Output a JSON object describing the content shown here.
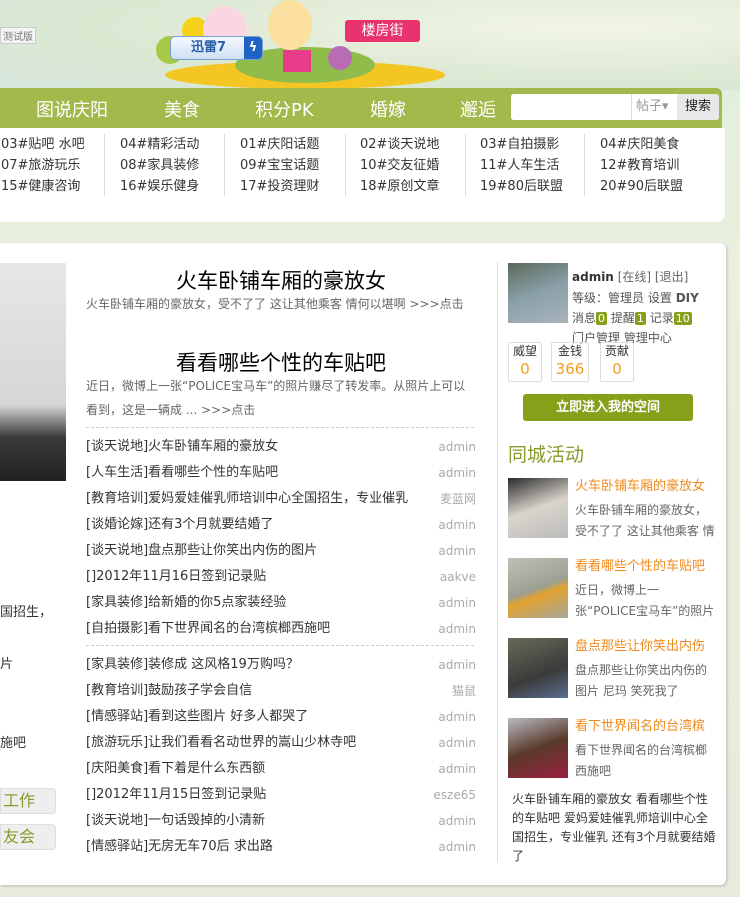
{
  "header": {
    "test_label": "测试版",
    "xunlei_label": "迅雷7",
    "loufang_label": "楼房街"
  },
  "nav": {
    "items": [
      "图说庆阳",
      "美食",
      "积分PK",
      "婚嫁",
      "邂逅"
    ],
    "search_placeholder": "",
    "search_type": "帖子▾",
    "search_button": "搜索",
    "color": "#a4b94c"
  },
  "categories": [
    [
      "03#贴吧 水吧",
      "07#旅游玩乐",
      "15#健康咨询"
    ],
    [
      "04#精彩活动",
      "08#家具装修",
      "16#娱乐健身"
    ],
    [
      "01#庆阳话题",
      "09#宝宝话题",
      "17#投资理财"
    ],
    [
      "02#谈天说地",
      "10#交友征婚",
      "18#原创文章"
    ],
    [
      "03#自拍摄影",
      "11#人车生活",
      "19#80后联盟"
    ],
    [
      "04#庆阳美食",
      "12#教育培训",
      "20#90后联盟"
    ]
  ],
  "left_fragments": {
    "lines": [
      "国招生，",
      "片",
      "施吧"
    ],
    "buttons": [
      "工作",
      "友会"
    ]
  },
  "headlines": [
    {
      "title": "火车卧铺车厢的豪放女",
      "summary": "火车卧铺车厢的豪放女，受不了了 这让其他乘客 情何以堪啊",
      "more": ">>>点击"
    },
    {
      "title": "看看哪些个性的车贴吧",
      "summary": "近日，微博上一张“POLICE宝马车”的照片赚尽了转发率。从照片上可以看到，这是一辆成 ...",
      "more": ">>>点击"
    }
  ],
  "threads_a": [
    {
      "title": "[谈天说地]火车卧铺车厢的豪放女",
      "author": "admin"
    },
    {
      "title": "[人车生活]看看哪些个性的车贴吧",
      "author": "admin"
    },
    {
      "title": "[教育培训]爱妈爱娃催乳师培训中心全国招生，专业催乳",
      "author": "麦蓝网"
    },
    {
      "title": "[谈婚论嫁]还有3个月就要结婚了",
      "author": "admin"
    },
    {
      "title": "[谈天说地]盘点那些让你笑出内伤的图片",
      "author": "admin"
    },
    {
      "title": "[]2012年11月16日签到记录贴",
      "author": "aakve"
    },
    {
      "title": "[家具装修]给新婚的你5点家装经验",
      "author": "admin"
    },
    {
      "title": "[自拍摄影]看下世界闻名的台湾槟榔西施吧",
      "author": "admin"
    }
  ],
  "threads_b": [
    {
      "title": "[家具装修]装修成 这风格19万购吗？",
      "author": "admin"
    },
    {
      "title": "[教育培训]鼓励孩子学会自信",
      "author": "猫鼠"
    },
    {
      "title": "[情感驿站]看到这些图片 好多人都哭了",
      "author": "admin"
    },
    {
      "title": "[旅游玩乐]让我们看看名动世界的嵩山少林寺吧",
      "author": "admin"
    },
    {
      "title": "[庆阳美食]看下着是什么东西额",
      "author": "admin"
    },
    {
      "title": "[]2012年11月15日签到记录贴",
      "author": "esze65"
    },
    {
      "title": "[谈天说地]一句话毁掉的小清新",
      "author": "admin"
    },
    {
      "title": "[情感驿站]无房无车70后 求出路",
      "author": "admin"
    }
  ],
  "user": {
    "name": "admin",
    "online": "[在线]",
    "logout": "[退出]",
    "level_label": "等级：管理员",
    "settings": "设置",
    "diy": "DIY",
    "msg_label": "消息",
    "msg_count": "0",
    "remind_label": "提醒",
    "remind_count": "1",
    "log_label": "记录",
    "log_count": "10",
    "portal_admin": "门户管理",
    "admin_center": "管理中心",
    "stats": [
      {
        "label": "威望",
        "value": "0"
      },
      {
        "label": "金钱",
        "value": "366"
      },
      {
        "label": "贡献",
        "value": "0"
      }
    ],
    "space_button": "立即进入我的空间"
  },
  "activities": {
    "title": "同城活动",
    "items": [
      {
        "title": "火车卧铺车厢的豪放女",
        "desc": "火车卧铺车厢的豪放女，受不了了 这让其他乘客 情"
      },
      {
        "title": "看看哪些个性的车贴吧",
        "desc": "近日，微博上一张“POLICE宝马车”的照片"
      },
      {
        "title": "盘点那些让你笑出内伤",
        "desc": "盘点那些让你笑出内伤的图片 尼玛 笑死我了"
      },
      {
        "title": "看下世界闻名的台湾槟",
        "desc": "看下世界闻名的台湾槟榔西施吧"
      }
    ],
    "footer_text": "火车卧铺车厢的豪放女 看看哪些个性的车贴吧 爱妈爱娃催乳师培训中心全国招生，专业催乳 还有3个月就要结婚了"
  }
}
